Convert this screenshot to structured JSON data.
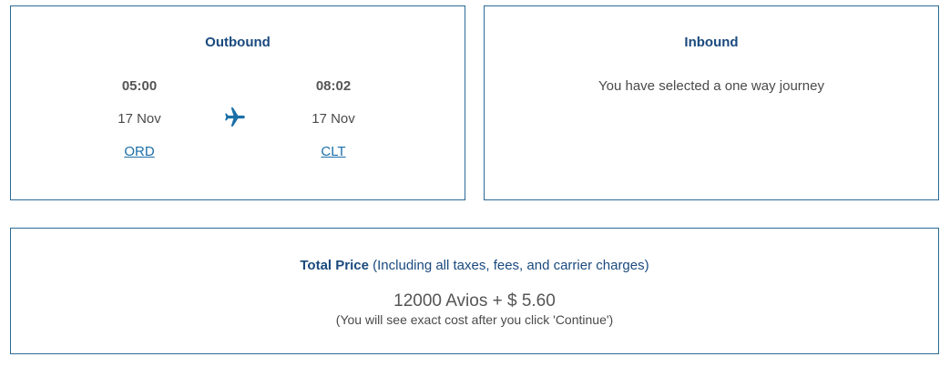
{
  "outbound": {
    "title": "Outbound",
    "departure": {
      "time": "05:00",
      "date": "17 Nov",
      "airport": "ORD"
    },
    "arrival": {
      "time": "08:02",
      "date": "17 Nov",
      "airport": "CLT"
    },
    "icon": "airplane-icon"
  },
  "inbound": {
    "title": "Inbound",
    "message": "You have selected a one way journey"
  },
  "price": {
    "label": "Total Price",
    "label_note": " (Including all taxes, fees, and carrier charges)",
    "amount": "12000 Avios + $ 5.60",
    "note": "(You will see exact cost after you click 'Continue')"
  },
  "colors": {
    "border": "#2b6a96",
    "heading": "#1a4a7e",
    "link": "#1a6fa8"
  }
}
